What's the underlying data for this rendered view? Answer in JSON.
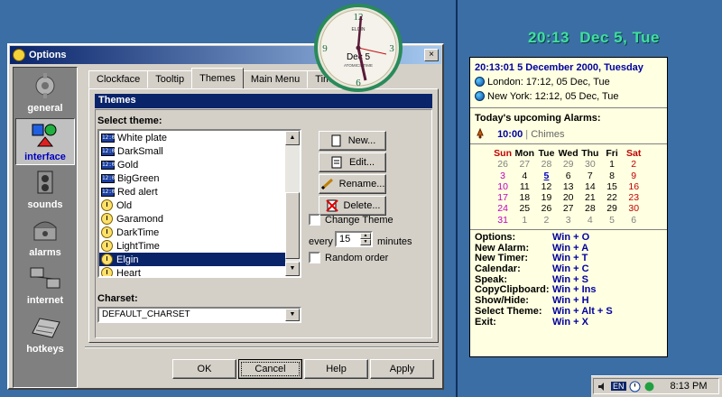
{
  "dialog": {
    "title": "Options",
    "close_label": "×",
    "sidebar": [
      {
        "label": "general",
        "icon": "gear-icon",
        "active": false
      },
      {
        "label": "interface",
        "icon": "interface-icon",
        "active": true
      },
      {
        "label": "sounds",
        "icon": "speaker-icon",
        "active": false
      },
      {
        "label": "alarms",
        "icon": "alarm-phone-icon",
        "active": false
      },
      {
        "label": "internet",
        "icon": "network-icon",
        "active": false
      },
      {
        "label": "hotkeys",
        "icon": "keyboard-icon",
        "active": false
      }
    ],
    "tabs": [
      "Clockface",
      "Tooltip",
      "Themes",
      "Main Menu",
      "Time Zones"
    ],
    "active_tab": "Themes",
    "section_title": "Themes",
    "select_theme_label": "Select theme:",
    "themes": [
      {
        "name": "White plate",
        "kind": "digital",
        "selected": false
      },
      {
        "name": "DarkSmall",
        "kind": "digital",
        "selected": false
      },
      {
        "name": "Gold",
        "kind": "digital",
        "selected": false
      },
      {
        "name": "BigGreen",
        "kind": "digital",
        "selected": false
      },
      {
        "name": "Red alert",
        "kind": "digital",
        "selected": false
      },
      {
        "name": "Old",
        "kind": "analog",
        "selected": false
      },
      {
        "name": "Garamond",
        "kind": "analog",
        "selected": false
      },
      {
        "name": "DarkTime",
        "kind": "analog",
        "selected": false
      },
      {
        "name": "LightTime",
        "kind": "analog",
        "selected": false
      },
      {
        "name": "Elgin",
        "kind": "analog",
        "selected": true
      },
      {
        "name": "Heart",
        "kind": "analog",
        "selected": false
      }
    ],
    "buttons": {
      "new": "New...",
      "edit": "Edit...",
      "rename": "Rename...",
      "delete": "Delete..."
    },
    "change_theme_label": "Change Theme",
    "every_label": "every",
    "every_value": "15",
    "minutes_label": "minutes",
    "random_order_label": "Random order",
    "charset_label": "Charset:",
    "charset_value": "DEFAULT_CHARSET",
    "ok": "OK",
    "cancel": "Cancel",
    "help": "Help",
    "apply": "Apply"
  },
  "clock_widget": {
    "brand": "ELGIN",
    "date": "Dec 5",
    "tagline": "ATOMICS TIME",
    "numerals": [
      "12",
      "3",
      "6",
      "9"
    ]
  },
  "right_pane": {
    "big_time": "20:13",
    "big_date": "Dec 5, Tue",
    "header": "20:13:01  5 December 2000, Tuesday",
    "zones": [
      "London: 17:12, 05 Dec, Tue",
      "New York: 12:12, 05 Dec, Tue"
    ],
    "alarms_title": "Today's upcoming Alarms:",
    "alarm_time": "10:00",
    "alarm_name": "Chimes",
    "calendar": {
      "weekdays": [
        "Sun",
        "Mon",
        "Tue",
        "Wed",
        "Thu",
        "Fri",
        "Sat"
      ],
      "weeks": [
        [
          "26",
          "27",
          "28",
          "29",
          "30",
          "1",
          "2"
        ],
        [
          "3",
          "4",
          "5",
          "6",
          "7",
          "8",
          "9"
        ],
        [
          "10",
          "11",
          "12",
          "13",
          "14",
          "15",
          "16"
        ],
        [
          "17",
          "18",
          "19",
          "20",
          "21",
          "22",
          "23"
        ],
        [
          "24",
          "25",
          "26",
          "27",
          "28",
          "29",
          "30"
        ],
        [
          "31",
          "1",
          "2",
          "3",
          "4",
          "5",
          "6"
        ]
      ],
      "today": "5"
    },
    "hotkeys": [
      {
        "action": "Options:",
        "keys": "Win + O"
      },
      {
        "action": "New Alarm:",
        "keys": "Win + A"
      },
      {
        "action": "New Timer:",
        "keys": "Win + T"
      },
      {
        "action": "Calendar:",
        "keys": "Win + C"
      },
      {
        "action": "Speak:",
        "keys": "Win + S"
      },
      {
        "action": "CopyClipboard:",
        "keys": "Win + Ins"
      },
      {
        "action": "Show/Hide:",
        "keys": "Win + H"
      },
      {
        "action": "Select Theme:",
        "keys": "Win + Alt + S"
      },
      {
        "action": "Exit:",
        "keys": "Win + X"
      }
    ]
  },
  "taskbar": {
    "lang": "EN",
    "time": "8:13 PM"
  }
}
